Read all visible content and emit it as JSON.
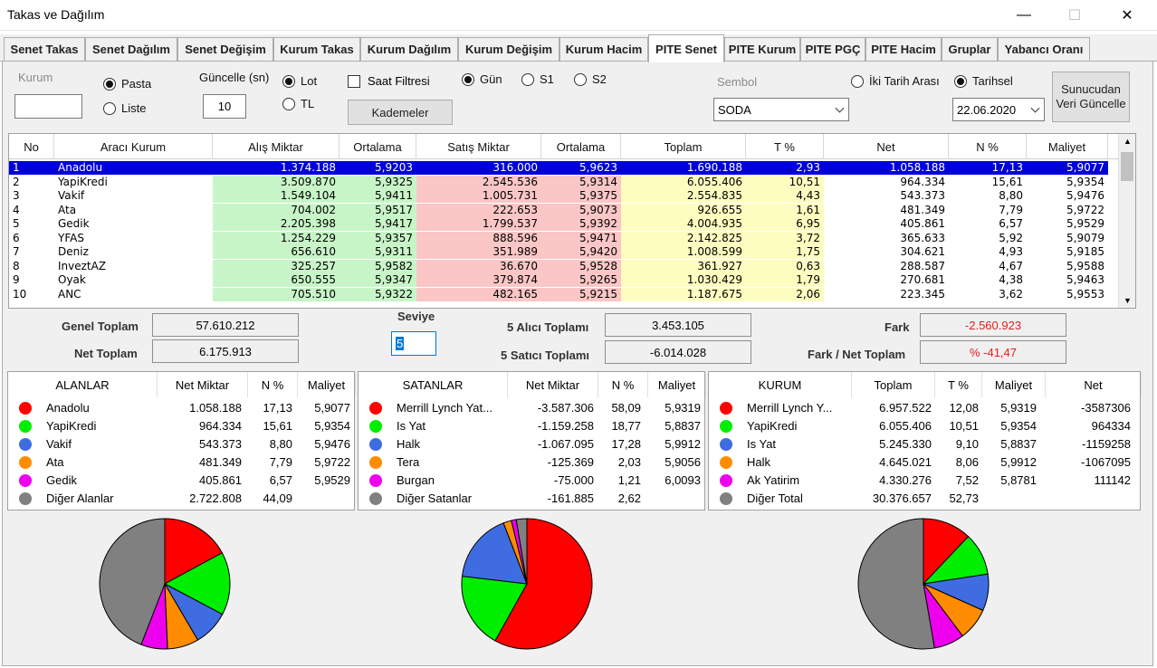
{
  "window": {
    "title": "Takas ve Dağılım",
    "minimize": "—",
    "maximize": "☐",
    "close": "✕"
  },
  "tabs": [
    "Senet Takas",
    "Senet Dağılım",
    "Senet Değişim",
    "Kurum Takas",
    "Kurum Dağılım",
    "Kurum Değişim",
    "Kurum Hacim",
    "PITE Senet",
    "PITE Kurum",
    "PITE PGÇ",
    "PITE Hacim",
    "Gruplar",
    "Yabancı Oranı"
  ],
  "active_tab": "PITE Senet",
  "controls": {
    "kurum_label": "Kurum",
    "kurum_value": "",
    "pasta": "Pasta",
    "liste": "Liste",
    "guncelle_label": "Güncelle (sn)",
    "guncelle_value": "10",
    "lot": "Lot",
    "tl": "TL",
    "saat_filtresi": "Saat Filtresi",
    "kademeler": "Kademeler",
    "gun": "Gün",
    "s1": "S1",
    "s2": "S2",
    "sembol_label": "Sembol",
    "sembol_value": "SODA",
    "iki_tarih": "İki Tarih Arası",
    "tarihsel": "Tarihsel",
    "date_value": "22.06.2020",
    "sunucu_button": "Sunucudan Veri Güncelle"
  },
  "grid": {
    "headers": [
      "No",
      "Aracı Kurum",
      "Alış Miktar",
      "Ortalama",
      "Satış Miktar",
      "Ortalama",
      "Toplam",
      "T %",
      "Net",
      "N %",
      "Maliyet"
    ],
    "rows": [
      [
        "1",
        "Anadolu",
        "1.374.188",
        "5,9203",
        "316.000",
        "5,9623",
        "1.690.188",
        "2,93",
        "1.058.188",
        "17,13",
        "5,9077"
      ],
      [
        "2",
        "YapiKredi",
        "3.509.870",
        "5,9325",
        "2.545.536",
        "5,9314",
        "6.055.406",
        "10,51",
        "964.334",
        "15,61",
        "5,9354"
      ],
      [
        "3",
        "Vakif",
        "1.549.104",
        "5,9411",
        "1.005.731",
        "5,9375",
        "2.554.835",
        "4,43",
        "543.373",
        "8,80",
        "5,9476"
      ],
      [
        "4",
        "Ata",
        "704.002",
        "5,9517",
        "222.653",
        "5,9073",
        "926.655",
        "1,61",
        "481.349",
        "7,79",
        "5,9722"
      ],
      [
        "5",
        "Gedik",
        "2.205.398",
        "5,9417",
        "1.799.537",
        "5,9392",
        "4.004.935",
        "6,95",
        "405.861",
        "6,57",
        "5,9529"
      ],
      [
        "6",
        "YFAS",
        "1.254.229",
        "5,9357",
        "888.596",
        "5,9471",
        "2.142.825",
        "3,72",
        "365.633",
        "5,92",
        "5,9079"
      ],
      [
        "7",
        "Deniz",
        "656.610",
        "5,9311",
        "351.989",
        "5,9420",
        "1.008.599",
        "1,75",
        "304.621",
        "4,93",
        "5,9185"
      ],
      [
        "8",
        "InveztAZ",
        "325.257",
        "5,9582",
        "36.670",
        "5,9528",
        "361.927",
        "0,63",
        "288.587",
        "4,67",
        "5,9588"
      ],
      [
        "9",
        "Oyak",
        "650.555",
        "5,9347",
        "379.874",
        "5,9265",
        "1.030.429",
        "1,79",
        "270.681",
        "4,38",
        "5,9463"
      ],
      [
        "10",
        "ANC",
        "705.510",
        "5,9322",
        "482.165",
        "5,9215",
        "1.187.675",
        "2,06",
        "223.345",
        "3,62",
        "5,9553"
      ]
    ]
  },
  "summary": {
    "genel_toplam_label": "Genel Toplam",
    "genel_toplam": "57.610.212",
    "net_toplam_label": "Net Toplam",
    "net_toplam": "6.175.913",
    "seviye_label": "Seviye",
    "seviye_value": "5",
    "alici_label": "5  Alıcı Toplamı",
    "alici_value": "3.453.105",
    "satici_label": "5  Satıcı Toplamı",
    "satici_value": "-6.014.028",
    "fark_label": "Fark",
    "fark_value": "-2.560.923",
    "fark_net_label": "Fark / Net Toplam",
    "fark_net_value": "% -41,47"
  },
  "colors": {
    "red": "#ff0000",
    "green": "#00ee00",
    "blue": "#3f6ce0",
    "orange": "#ff8c00",
    "magenta": "#ee00ee",
    "gray": "#808080"
  },
  "alanlar": {
    "headers": [
      "ALANLAR",
      "Net Miktar",
      "N %",
      "Maliyet"
    ],
    "rows": [
      {
        "name": "Anadolu",
        "net": "1.058.188",
        "pct": "17,13",
        "cost": "5,9077",
        "color": "#ff0000"
      },
      {
        "name": "YapiKredi",
        "net": "964.334",
        "pct": "15,61",
        "cost": "5,9354",
        "color": "#00ee00"
      },
      {
        "name": "Vakif",
        "net": "543.373",
        "pct": "8,80",
        "cost": "5,9476",
        "color": "#3f6ce0"
      },
      {
        "name": "Ata",
        "net": "481.349",
        "pct": "7,79",
        "cost": "5,9722",
        "color": "#ff8c00"
      },
      {
        "name": "Gedik",
        "net": "405.861",
        "pct": "6,57",
        "cost": "5,9529",
        "color": "#ee00ee"
      },
      {
        "name": "Diğer Alanlar",
        "net": "2.722.808",
        "pct": "44,09",
        "cost": "",
        "color": "#808080"
      }
    ],
    "pie": [
      17.13,
      15.61,
      8.8,
      7.79,
      6.57,
      44.09
    ]
  },
  "satanlar": {
    "headers": [
      "SATANLAR",
      "Net Miktar",
      "N %",
      "Maliyet"
    ],
    "rows": [
      {
        "name": "Merrill Lynch Yat...",
        "net": "-3.587.306",
        "pct": "58,09",
        "cost": "5,9319",
        "color": "#ff0000"
      },
      {
        "name": "Is Yat",
        "net": "-1.159.258",
        "pct": "18,77",
        "cost": "5,8837",
        "color": "#00ee00"
      },
      {
        "name": "Halk",
        "net": "-1.067.095",
        "pct": "17,28",
        "cost": "5,9912",
        "color": "#3f6ce0"
      },
      {
        "name": "Tera",
        "net": "-125.369",
        "pct": "2,03",
        "cost": "5,9056",
        "color": "#ff8c00"
      },
      {
        "name": "Burgan",
        "net": "-75.000",
        "pct": "1,21",
        "cost": "6,0093",
        "color": "#ee00ee"
      },
      {
        "name": "Diğer Satanlar",
        "net": "-161.885",
        "pct": "2,62",
        "cost": "",
        "color": "#808080"
      }
    ],
    "pie": [
      58.09,
      18.77,
      17.28,
      2.03,
      1.21,
      2.62
    ]
  },
  "kurum": {
    "headers": [
      "KURUM",
      "Toplam",
      "T %",
      "Maliyet",
      "Net"
    ],
    "rows": [
      {
        "name": "Merrill Lynch Y...",
        "total": "6.957.522",
        "pct": "12,08",
        "cost": "5,9319",
        "net": "-3587306",
        "color": "#ff0000"
      },
      {
        "name": "YapiKredi",
        "total": "6.055.406",
        "pct": "10,51",
        "cost": "5,9354",
        "net": "964334",
        "color": "#00ee00"
      },
      {
        "name": "Is Yat",
        "total": "5.245.330",
        "pct": "9,10",
        "cost": "5,8837",
        "net": "-1159258",
        "color": "#3f6ce0"
      },
      {
        "name": "Halk",
        "total": "4.645.021",
        "pct": "8,06",
        "cost": "5,9912",
        "net": "-1067095",
        "color": "#ff8c00"
      },
      {
        "name": "Ak Yatirim",
        "total": "4.330.276",
        "pct": "7,52",
        "cost": "5,8781",
        "net": "111142",
        "color": "#ee00ee"
      },
      {
        "name": "Diğer Total",
        "total": "30.376.657",
        "pct": "52,73",
        "cost": "",
        "net": "",
        "color": "#808080"
      }
    ],
    "pie": [
      12.08,
      10.51,
      9.1,
      8.06,
      7.52,
      52.73
    ]
  }
}
